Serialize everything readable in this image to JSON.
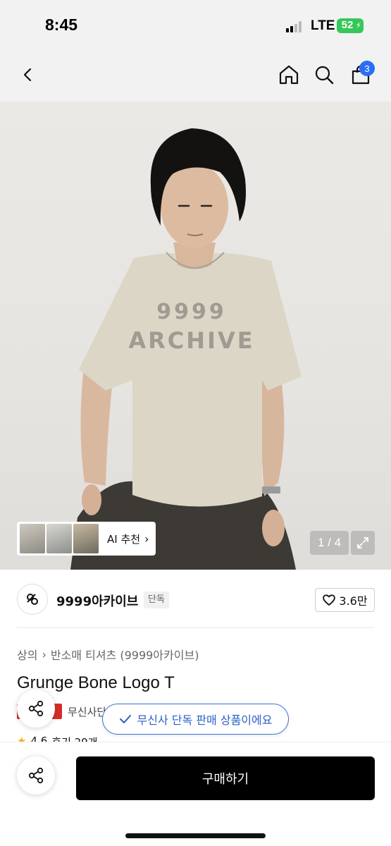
{
  "status_bar": {
    "time": "8:45",
    "network": "LTE",
    "battery": "52",
    "battery_color": "#35c759"
  },
  "nav": {
    "back_icon": "chevron-left-icon",
    "home_icon": "home-icon",
    "search_icon": "search-icon",
    "cart_icon": "shopping-bag-icon",
    "cart_count": "3",
    "badge_color": "#2b6ef5"
  },
  "gallery": {
    "ai_recommend_label": "AI 추천",
    "counter": "1 / 4",
    "expand_icon": "expand-icon",
    "shirt_print_line1": "9999",
    "shirt_print_line2": "ARCHIVE"
  },
  "brand": {
    "name": "9999아카이브",
    "tag": "단독",
    "like_count": "3.6만",
    "like_icon": "heart-icon"
  },
  "product": {
    "breadcrumb": [
      "상의",
      "반소매 티셔츠 (9999아카이브)"
    ],
    "title": "Grunge Bone Logo T",
    "store_label": "무신사단",
    "rating": "4.6",
    "reviews": "후기 29개",
    "exclusive_toast": "무신사 단독 판매 상품이에요"
  },
  "actions": {
    "share_icon": "share-icon",
    "buy_label": "구매하기",
    "buy_color": "#000000"
  }
}
